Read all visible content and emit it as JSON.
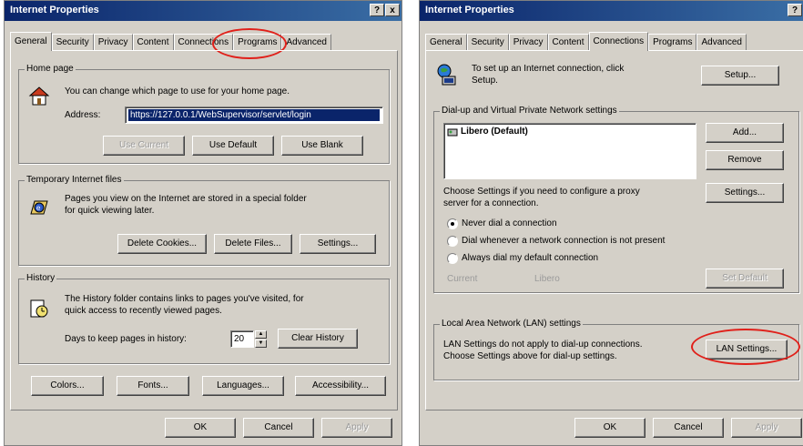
{
  "left": {
    "title": "Internet Properties",
    "help_btn": "?",
    "close_btn": "x",
    "tabs": [
      "General",
      "Security",
      "Privacy",
      "Content",
      "Connections",
      "Programs",
      "Advanced"
    ],
    "home": {
      "label": "Home page",
      "desc": "You can change which page to use for your home page.",
      "address_label": "Address:",
      "address_value": "https://127.0.0.1/WebSupervisor/servlet/login",
      "use_current": "Use Current",
      "use_default": "Use Default",
      "use_blank": "Use Blank"
    },
    "temp": {
      "label": "Temporary Internet files",
      "desc_1": "Pages you view on the Internet are stored in a special folder",
      "desc_2": "for quick viewing later.",
      "delete_cookies": "Delete Cookies...",
      "delete_files": "Delete Files...",
      "settings": "Settings..."
    },
    "history": {
      "label": "History",
      "desc_1": "The History folder contains links to pages you've visited, for",
      "desc_2": "quick access to recently viewed pages.",
      "days_label": "Days to keep pages in history:",
      "days_value": "20",
      "clear": "Clear History"
    },
    "bottom": {
      "colors": "Colors...",
      "fonts": "Fonts...",
      "languages": "Languages...",
      "accessibility": "Accessibility..."
    },
    "ok": "OK",
    "cancel": "Cancel",
    "apply": "Apply"
  },
  "right": {
    "title": "Internet Properties",
    "help_btn": "?",
    "close_btn": "x",
    "tabs": [
      "General",
      "Security",
      "Privacy",
      "Content",
      "Connections",
      "Programs",
      "Advanced"
    ],
    "setup_text_1": "To set up an Internet connection, click",
    "setup_text_2": "Setup.",
    "setup_btn": "Setup...",
    "dialup": {
      "label": "Dial-up and Virtual Private Network settings",
      "item": "Libero (Default)",
      "add": "Add...",
      "remove": "Remove",
      "choose_1": "Choose Settings if you need to configure a proxy",
      "choose_2": "server for a connection.",
      "settings": "Settings...",
      "radio_1": "Never dial a connection",
      "radio_2": "Dial whenever a network connection is not present",
      "radio_3": "Always dial my default connection",
      "current_label": "Current",
      "current_value": "Libero",
      "set_default": "Set Default"
    },
    "lan": {
      "label": "Local Area Network (LAN) settings",
      "desc_1": "LAN Settings do not apply to dial-up connections.",
      "desc_2": "Choose Settings above for dial-up settings.",
      "button": "LAN Settings..."
    },
    "ok": "OK",
    "cancel": "Cancel",
    "apply": "Apply"
  },
  "colors": {
    "annotation": "#e0201a",
    "titlebar": "#0a246a",
    "face": "#d4d0c8"
  }
}
